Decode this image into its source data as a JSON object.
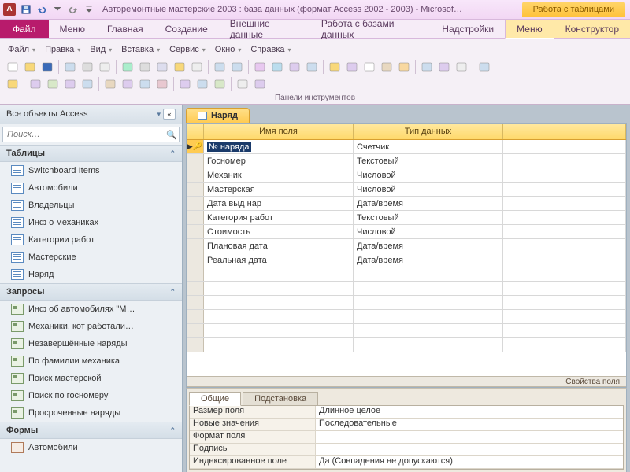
{
  "title": "Авторемонтные мастерские 2003 : база данных (формат Access 2002 - 2003) - Microsof…",
  "context_tab": "Работа с таблицами",
  "file_tab": "Файл",
  "ribbon_tabs": [
    "Меню",
    "Главная",
    "Создание",
    "Внешние данные",
    "Работа с базами данных",
    "Надстройки"
  ],
  "ctx_tabs": [
    "Меню",
    "Конструктор"
  ],
  "menu": [
    "Файл",
    "Правка",
    "Вид",
    "Вставка",
    "Сервис",
    "Окно",
    "Справка"
  ],
  "ribbon_group": "Панели инструментов",
  "nav": {
    "header": "Все объекты Access",
    "search_ph": "Поиск…",
    "groups": {
      "tables": "Таблицы",
      "queries": "Запросы",
      "forms": "Формы"
    },
    "tables": [
      "Switchboard Items",
      "Автомобили",
      "Владельцы",
      "Инф о механиках",
      "Категории работ",
      "Мастерские",
      "Наряд"
    ],
    "queries": [
      "Инф об автомобилях \"М…",
      "Механики, кот работали…",
      "Незавершённые наряды",
      "По фамилии механика",
      "Поиск мастерской",
      "Поиск по госномеру",
      "Просроченные наряды"
    ],
    "forms": [
      "Автомобили"
    ]
  },
  "doc_tab": "Наряд",
  "cols": {
    "name": "Имя поля",
    "type": "Тип данных"
  },
  "rows": [
    {
      "name": "№ наряда",
      "type": "Счетчик",
      "key": true,
      "sel": true
    },
    {
      "name": "Госномер",
      "type": "Текстовый"
    },
    {
      "name": "Механик",
      "type": "Числовой"
    },
    {
      "name": "Мастерская",
      "type": "Числовой"
    },
    {
      "name": "Дата выд нар",
      "type": "Дата/время"
    },
    {
      "name": "Категория работ",
      "type": "Текстовый"
    },
    {
      "name": "Стоимость",
      "type": "Числовой"
    },
    {
      "name": "Плановая дата",
      "type": "Дата/время"
    },
    {
      "name": "Реальная дата",
      "type": "Дата/время"
    }
  ],
  "blank_rows": 6,
  "props_title": "Свойства поля",
  "prop_tabs": {
    "general": "Общие",
    "lookup": "Подстановка"
  },
  "props": [
    {
      "label": "Размер поля",
      "val": "Длинное целое"
    },
    {
      "label": "Новые значения",
      "val": "Последовательные"
    },
    {
      "label": "Формат поля",
      "val": ""
    },
    {
      "label": "Подпись",
      "val": ""
    },
    {
      "label": "Индексированное поле",
      "val": "Да (Совпадения не допускаются)"
    }
  ]
}
